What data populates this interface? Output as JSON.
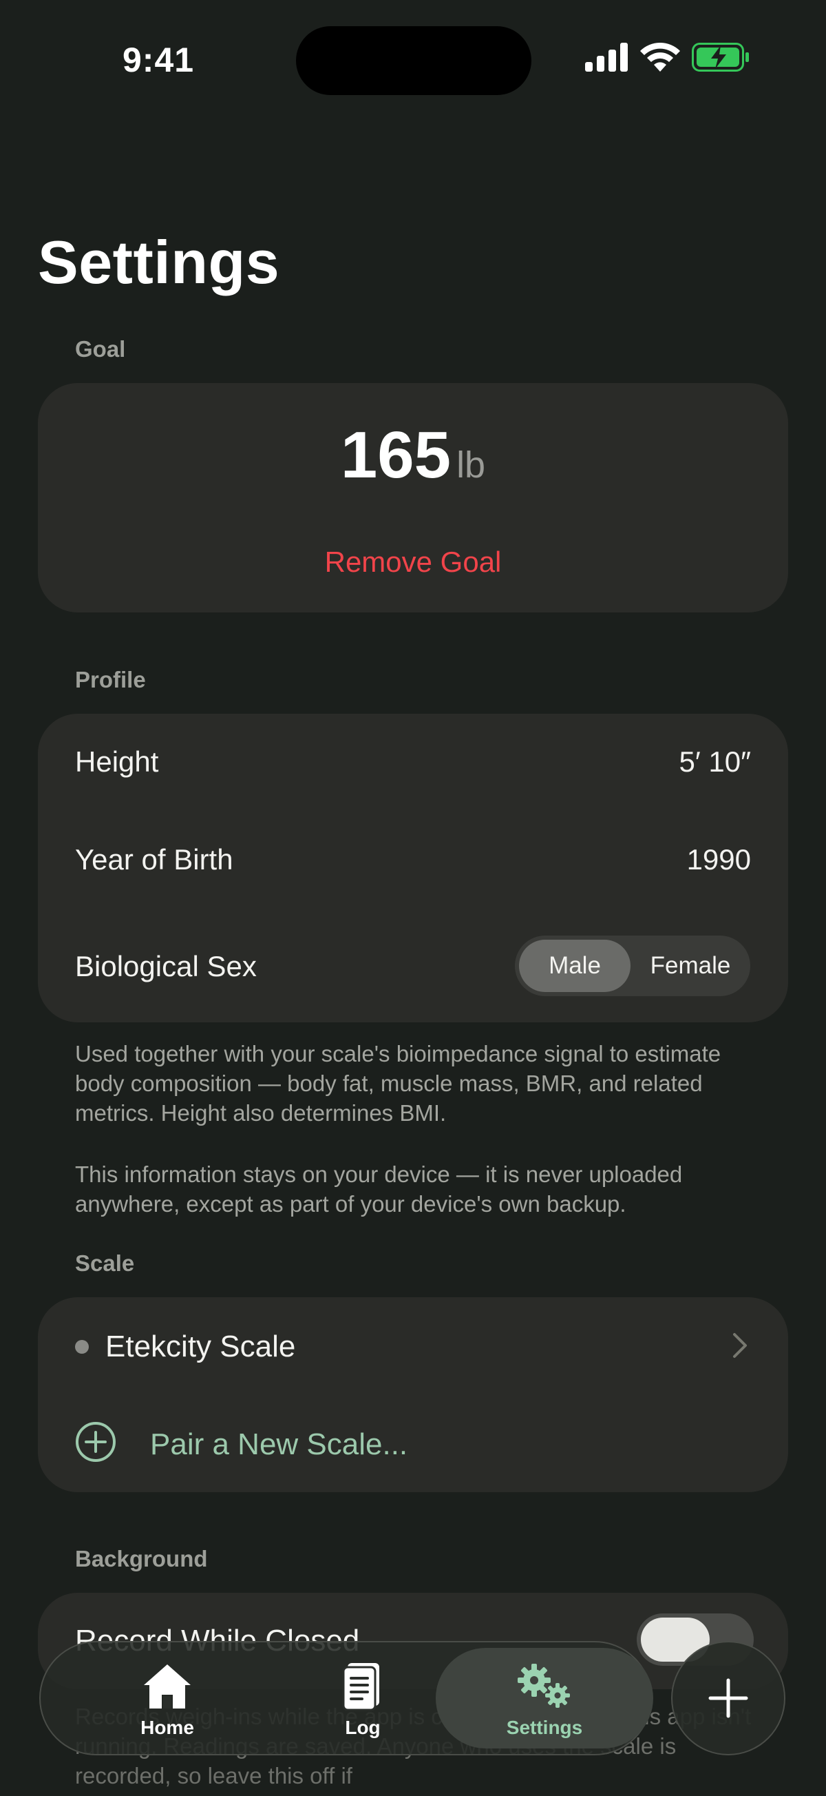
{
  "status_bar": {
    "time": "9:41"
  },
  "page": {
    "title": "Settings"
  },
  "goal": {
    "header": "Goal",
    "value": "165",
    "unit": "lb",
    "remove_label": "Remove Goal"
  },
  "profile": {
    "header": "Profile",
    "height_label": "Height",
    "height_value": "5′ 10″",
    "year_label": "Year of Birth",
    "year_value": "1990",
    "sex_label": "Biological Sex",
    "sex_options": [
      "Male",
      "Female"
    ],
    "sex_selected": "Male",
    "footnote_1": "Used together with your scale's bioimpedance signal to estimate body composition — body fat, muscle mass, BMR, and related metrics. Height also determines BMI.",
    "footnote_2": "This information stays on your device — it is never uploaded anywhere, except as part of your device's own backup."
  },
  "scale": {
    "header": "Scale",
    "device_name": "Etekcity Scale",
    "pair_label": "Pair a New Scale..."
  },
  "background": {
    "header": "Background",
    "record_label": "Record While Closed",
    "record_enabled": false,
    "footnote": "Records weigh-ins while the app is closed, even when this app isn't running. Readings are saved. Anyone who uses the scale is recorded, so leave this off if"
  },
  "tabbar": {
    "home_label": "Home",
    "log_label": "Log",
    "settings_label": "Settings",
    "active": "Settings"
  },
  "colors": {
    "background": "#1b1f1c",
    "card": "#2a2b28",
    "accent_green": "#9bd3b1",
    "destructive_red": "#f1444a",
    "battery_green": "#35c759"
  }
}
